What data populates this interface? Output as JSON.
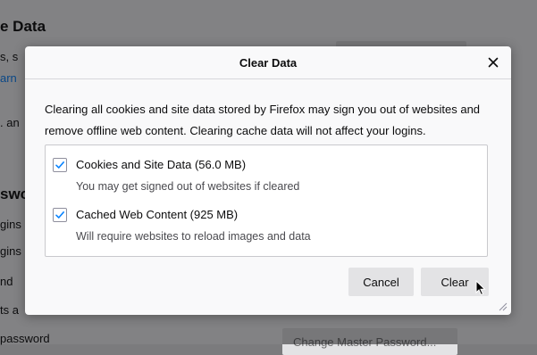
{
  "background": {
    "heading_1": "e Data",
    "line_1": "s, s",
    "link_1": "arn",
    "line_2": ". an",
    "heading_2": "swo",
    "line_3": "gins",
    "line_4": "gins",
    "line_5": "nd",
    "line_6": "ts a",
    "line_7": "password",
    "master_password_button": "Change Master Password..."
  },
  "dialog": {
    "title": "Clear Data",
    "close_glyph": "✕",
    "description": "Clearing all cookies and site data stored by Firefox may sign you out of websites and remove offline web content. Clearing cache data will not affect your logins.",
    "options": [
      {
        "label": "Cookies and Site Data (56.0 MB)",
        "sublabel": "You may get signed out of websites if cleared",
        "checked": true
      },
      {
        "label": "Cached Web Content (925 MB)",
        "sublabel": "Will require websites to reload images and data",
        "checked": true
      }
    ],
    "cancel_label": "Cancel",
    "clear_label": "Clear"
  },
  "colors": {
    "accent": "#0a84ff",
    "button_bg": "#e3e3e5",
    "overlay": "rgba(12,12,13,0.5)"
  },
  "icons": {
    "checkbox": "checkmark-icon",
    "close": "close-icon",
    "resize": "resize-grip-icon",
    "pointer": "mouse-pointer-icon"
  }
}
